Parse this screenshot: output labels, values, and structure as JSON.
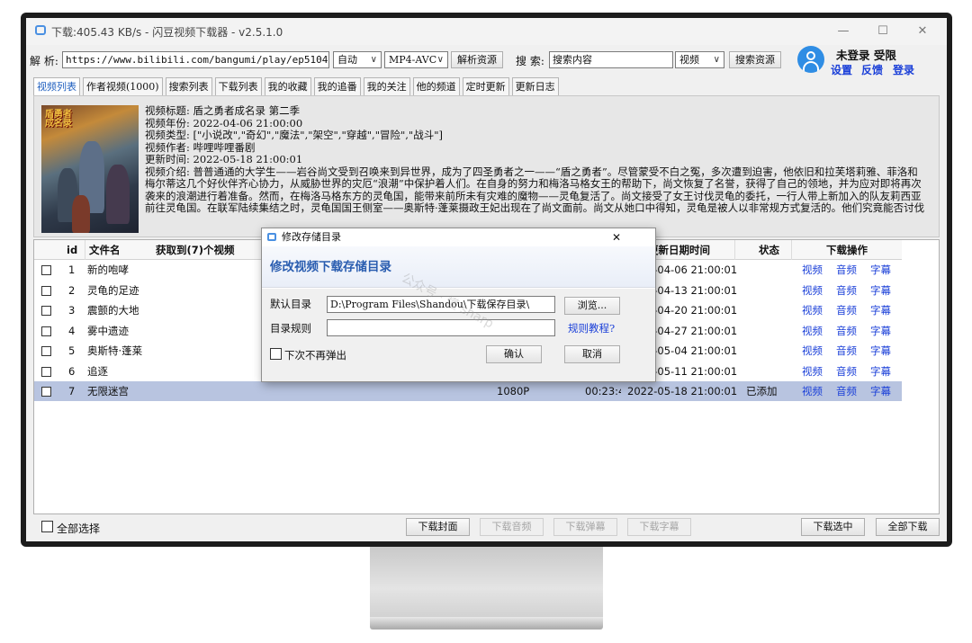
{
  "window": {
    "title": "下载:405.43 KB/s - 闪豆视频下载器 - v2.5.1.0",
    "minimize": "—",
    "maximize": "☐",
    "close": "✕"
  },
  "toolbar": {
    "parse_label": "解 析:",
    "url": "https://www.bilibili.com/bangumi/play/ep510498?fr",
    "mode": "自动",
    "codec": "MP4-AVC",
    "parse_button": "解析资源",
    "search_label": "搜 索:",
    "search_placeholder": "搜索内容",
    "search_type": "视频",
    "search_button": "搜索资源"
  },
  "user": {
    "status": "未登录 受限",
    "settings": "设置",
    "feedback": "反馈",
    "login": "登录"
  },
  "tabs": [
    "视频列表",
    "作者视频(1000)",
    "搜索列表",
    "下载列表",
    "我的收藏",
    "我的追番",
    "我的关注",
    "他的频道",
    "定时更新",
    "更新日志"
  ],
  "info": {
    "poster_text": "盾勇者成名录",
    "title_line": "视频标题: 盾之勇者成名录 第二季",
    "year_line": "视频年份: 2022-04-06 21:00:00",
    "type_line": "视频类型: [\"小说改\",\"奇幻\",\"魔法\",\"架空\",\"穿越\",\"冒险\",\"战斗\"]",
    "author_line": "视频作者: 哔哩哔哩番剧",
    "update_line": "更新时间: 2022-05-18 21:00:01",
    "desc_line": "视频介绍: 普普通通的大学生——岩谷尚文受到召唤来到异世界，成为了四圣勇者之一——“盾之勇者”。尽管蒙受不白之冤，多次遭到迫害，他依旧和拉芙塔莉雅、菲洛和梅尔蒂这几个好伙伴齐心协力，从威胁世界的灾厄“浪潮”中保护着人们。在自身的努力和梅洛马格女王的帮助下，尚文恢复了名誉，获得了自己的领地，并为应对即将再次袭来的浪潮进行着准备。然而，在梅洛马格东方的灵龟国，能带来前所未有灾难的魔物——灵龟复活了。尚文接受了女王讨伐灵龟的委托，一行人带上新加入的队友莉西亚前往灵龟国。在联军陆续集结之时，灵龟国国王侧室——奥斯特·蓬莱摄政王妃出现在了尚文面前。尚文从她口中得知，灵龟是被人以非常规方式复活的。他们究竟能否讨伐灵龟，揪出幕后黑手呢？为守护珍视之人，盾之勇者再次奔赴战场。"
  },
  "table": {
    "headers": {
      "id": "id",
      "filename": "文件名",
      "count": "获取到(7)个视频",
      "updated": "更新日期时间",
      "status": "状态",
      "actions": "下载操作"
    },
    "action_labels": {
      "video": "视频",
      "audio": "音频",
      "subtitle": "字幕"
    },
    "rows": [
      {
        "id": "1",
        "name": "新的咆哮",
        "quality": "",
        "duration": "",
        "date": "2022-04-06 21:00:01",
        "status": ""
      },
      {
        "id": "2",
        "name": "灵龟的足迹",
        "quality": "",
        "duration": "",
        "date": "2022-04-13 21:00:01",
        "status": ""
      },
      {
        "id": "3",
        "name": "震颤的大地",
        "quality": "",
        "duration": "",
        "date": "2022-04-20 21:00:01",
        "status": ""
      },
      {
        "id": "4",
        "name": "雾中遗迹",
        "quality": "",
        "duration": "",
        "date": "2022-04-27 21:00:01",
        "status": ""
      },
      {
        "id": "5",
        "name": "奥斯特·蓬莱",
        "quality": "",
        "duration": "",
        "date": "2022-05-04 21:00:01",
        "status": ""
      },
      {
        "id": "6",
        "name": "追逐",
        "quality": "",
        "duration": "",
        "date": "2022-05-11 21:00:01",
        "status": ""
      },
      {
        "id": "7",
        "name": "无限迷宫",
        "quality": "1080P",
        "duration": "00:23:4",
        "date": "2022-05-18 21:00:01",
        "status": "已添加"
      }
    ]
  },
  "bottom": {
    "select_all": "全部选择",
    "download_cover": "下载封面",
    "download_audio": "下载音频",
    "download_danmaku": "下载弹幕",
    "download_subtitle": "下载字幕",
    "download_selected": "下载选中",
    "download_all": "全部下载"
  },
  "dialog": {
    "title": "修改存储目录",
    "close": "✕",
    "header": "修改视频下载存储目录",
    "default_dir_label": "默认目录",
    "default_dir_value": "D:\\Program Files\\Shandou\\下载保存目录\\",
    "browse_button": "浏览...",
    "rule_label": "目录规则",
    "rule_value": "",
    "rule_tutorial": "规则教程?",
    "no_popup_label": "下次不再弹出",
    "confirm_button": "确认",
    "cancel_button": "取消",
    "watermark": "公众号 · 懂 sharp"
  },
  "colors": {
    "accent": "#2a5db0",
    "link": "#1a3fd8",
    "selected_row": "#b8c4e0"
  }
}
